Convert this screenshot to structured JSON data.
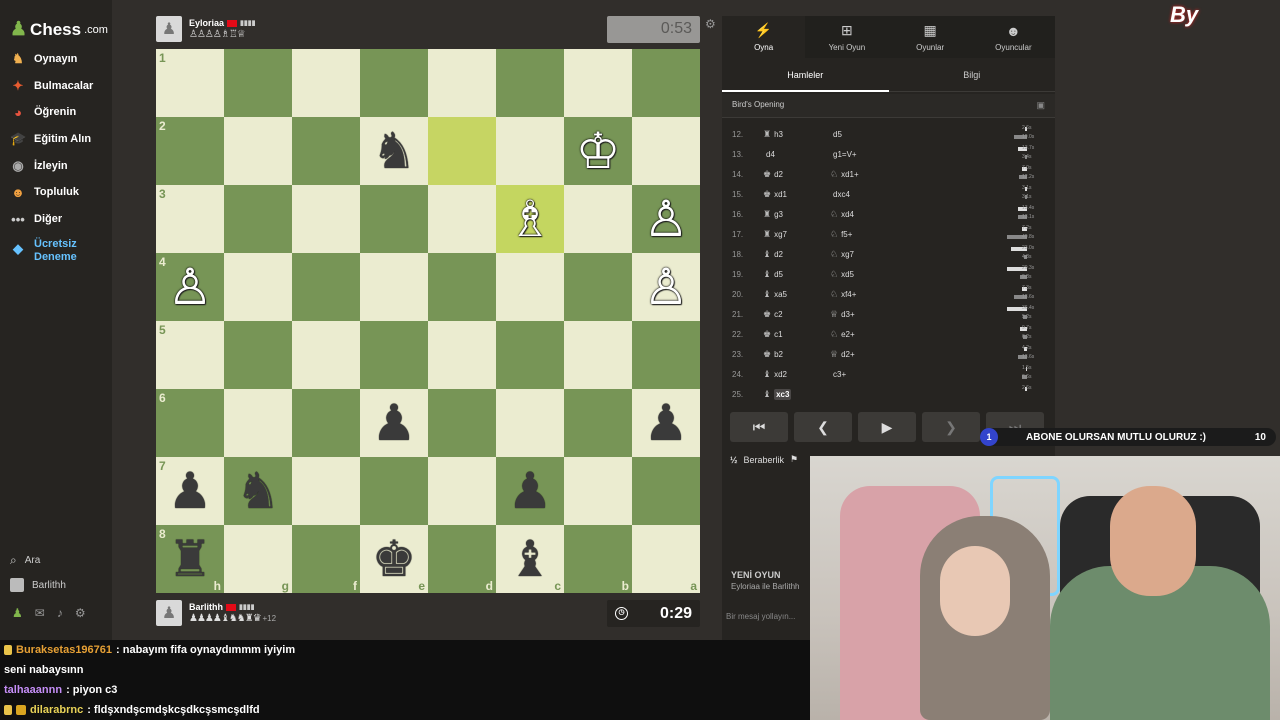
{
  "sidebar": {
    "logo": "Chess",
    "logo_suffix": ".com",
    "items": [
      {
        "label": "Oynayın",
        "icon": "play-icon"
      },
      {
        "label": "Bulmacalar",
        "icon": "puzzle-icon"
      },
      {
        "label": "Öğrenin",
        "icon": "learn-icon"
      },
      {
        "label": "Eğitim Alın",
        "icon": "coach-icon"
      },
      {
        "label": "İzleyin",
        "icon": "watch-icon"
      },
      {
        "label": "Topluluk",
        "icon": "community-icon"
      },
      {
        "label": "Diğer",
        "icon": "more-icon"
      }
    ],
    "free_trial": "Ücretsiz Deneme",
    "search": "Ara",
    "user": "Barlithh"
  },
  "top_player": {
    "name": "Eyloriaa",
    "captured": "♙♙♙♙♗♖♕",
    "clock": "0:53"
  },
  "bottom_player": {
    "name": "Barlithh",
    "captured": "♟♟♟♟♝♞♞♜♛",
    "advantage": "+12",
    "clock": "0:29"
  },
  "board": {
    "ranks": [
      "1",
      "2",
      "3",
      "4",
      "5",
      "6",
      "7",
      "8"
    ],
    "files": [
      "h",
      "g",
      "f",
      "e",
      "d",
      "c",
      "b",
      "a"
    ],
    "squares": [
      [
        "",
        "",
        "",
        "",
        "",
        "",
        "",
        ""
      ],
      [
        "",
        "",
        "",
        "♞",
        "",
        "",
        "♔",
        ""
      ],
      [
        "",
        "",
        "",
        "",
        "",
        "♗",
        "",
        "♙"
      ],
      [
        "♙",
        "",
        "",
        "",
        "",
        "",
        "",
        "♙"
      ],
      [
        "",
        "",
        "",
        "",
        "",
        "",
        "",
        ""
      ],
      [
        "",
        "",
        "",
        "♟",
        "",
        "",
        "",
        "♟"
      ],
      [
        "♟",
        "♞",
        "",
        "",
        "",
        "♟",
        "",
        ""
      ],
      [
        "♜",
        "",
        "",
        "♚",
        "",
        "♝",
        "",
        ""
      ]
    ]
  },
  "panel": {
    "tabs": [
      {
        "label": "Oyna",
        "icon": "play-icon"
      },
      {
        "label": "Yeni Oyun",
        "icon": "new-game-icon"
      },
      {
        "label": "Oyunlar",
        "icon": "games-icon"
      },
      {
        "label": "Oyuncular",
        "icon": "players-icon"
      }
    ],
    "subtabs": [
      "Hamleler",
      "Bilgi"
    ],
    "opening": "Bird's Opening",
    "moves": [
      {
        "n": "12.",
        "wp": "♜",
        "w": "h3",
        "bp": "",
        "b": "d5",
        "t1": "2.6s",
        "t2": "19.0s",
        "b1": 0.09,
        "b2": 0.65
      },
      {
        "n": "13.",
        "wp": "",
        "w": "d4",
        "bp": "",
        "b": "g1=V+",
        "t1": "13.7s",
        "t2": "3.4s",
        "b1": 0.47,
        "b2": 0.12
      },
      {
        "n": "14.",
        "wp": "♚",
        "w": "d2",
        "bp": "♘",
        "b": "xd1+",
        "t1": "7.0s",
        "t2": "12.2s",
        "b1": 0.24,
        "b2": 0.42
      },
      {
        "n": "15.",
        "wp": "♚",
        "w": "xd1",
        "bp": "",
        "b": "dxc4",
        "t1": "3.1s",
        "t2": "3.1s",
        "b1": 0.11,
        "b2": 0.11
      },
      {
        "n": "16.",
        "wp": "♜",
        "w": "g3",
        "bp": "♘",
        "b": "xd4",
        "t1": "13.4s",
        "t2": "13.1s",
        "b1": 0.46,
        "b2": 0.45
      },
      {
        "n": "17.",
        "wp": "♜",
        "w": "xg7",
        "bp": "♘",
        "b": "f5+",
        "t1": "7.2s",
        "t2": "49.8s",
        "b1": 0.25,
        "b2": 1.0
      },
      {
        "n": "18.",
        "wp": "♝",
        "w": "d2",
        "bp": "♘",
        "b": "xg7",
        "t1": "23.0s",
        "t2": "4.8s",
        "b1": 0.79,
        "b2": 0.17
      },
      {
        "n": "19.",
        "wp": "♝",
        "w": "d5",
        "bp": "♘",
        "b": "xd5",
        "t1": "29.3s",
        "t2": "9.8s",
        "b1": 1.0,
        "b2": 0.34
      },
      {
        "n": "20.",
        "wp": "♝",
        "w": "xa5",
        "bp": "♘",
        "b": "xf4+",
        "t1": "7.3s",
        "t2": "18.6s",
        "b1": 0.25,
        "b2": 0.64
      },
      {
        "n": "21.",
        "wp": "♚",
        "w": "c2",
        "bp": "♕",
        "b": "d3+",
        "t1": "36.4s",
        "t2": "5.2s",
        "b1": 1.0,
        "b2": 0.18
      },
      {
        "n": "22.",
        "wp": "♚",
        "w": "c1",
        "bp": "♘",
        "b": "e2+",
        "t1": "9.7s",
        "t2": "6.2s",
        "b1": 0.33,
        "b2": 0.21
      },
      {
        "n": "23.",
        "wp": "♚",
        "w": "b2",
        "bp": "♕",
        "b": "d2+",
        "t1": "4.2s",
        "t2": "13.6s",
        "b1": 0.14,
        "b2": 0.47
      },
      {
        "n": "24.",
        "wp": "♝",
        "w": "xd2",
        "bp": "",
        "b": "c3+",
        "t1": "1.5s",
        "t2": "6.6s",
        "b1": 0.05,
        "b2": 0.23
      },
      {
        "n": "25.",
        "wp": "♝",
        "w": "xc3",
        "bp": "",
        "b": "",
        "t1": "2.6s",
        "t2": "",
        "b1": 0.09,
        "b2": 0
      }
    ],
    "draw": "Beraberlik",
    "new_game_title": "YENİ OYUN",
    "new_game_sub": "Eyloriaa ile Barlithh",
    "chat_placeholder": "Bir mesaj yollayın..."
  },
  "stream": {
    "brand": "By",
    "subscribe_num": "1",
    "subscribe_text": "ABONE OLURSAN MUTLU OLURUZ :)",
    "subscribe_count": "10",
    "chat": [
      {
        "user": "Buraksetas196761",
        "msg": ": nabayım fifa oynaydımmm iyiyim",
        "badge": true
      },
      {
        "user": "",
        "msg": "seni nabaysınn",
        "badge": false
      },
      {
        "user": "talhaaannn",
        "msg": ": piyon c3",
        "badge": false
      },
      {
        "user": "dilarabrnc",
        "msg": ": fldşxndşcmdşkcşdkcşsmcşdlfd",
        "badge": true
      }
    ]
  },
  "colors": {
    "light_square": "#ebecd0",
    "dark_square": "#779556",
    "highlight": "#c6d563"
  }
}
